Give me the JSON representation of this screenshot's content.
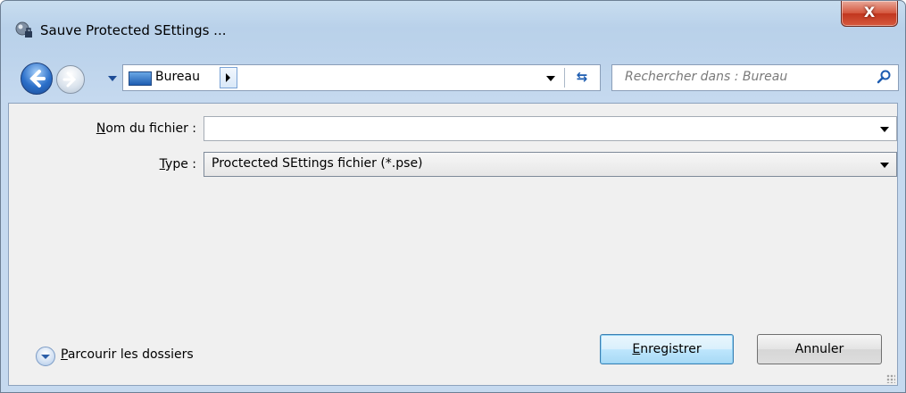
{
  "window": {
    "title": "Sauve Protected SEttings ...",
    "close_label": "X"
  },
  "nav": {
    "location": "Bureau",
    "search_placeholder": "Rechercher dans : Bureau"
  },
  "form": {
    "filename_label_first": "N",
    "filename_label_rest": "om du fichier :",
    "filename_value": "",
    "type_label_first": "T",
    "type_label_rest": "ype :",
    "type_value": "Proctected SEttings fichier (*.pse)"
  },
  "footer": {
    "browse_first": "P",
    "browse_rest": "arcourir les dossiers",
    "save_first": "E",
    "save_rest": "nregistrer",
    "cancel_label": "Annuler"
  },
  "colors": {
    "accent": "#1e5db1",
    "close": "#c1361e"
  }
}
